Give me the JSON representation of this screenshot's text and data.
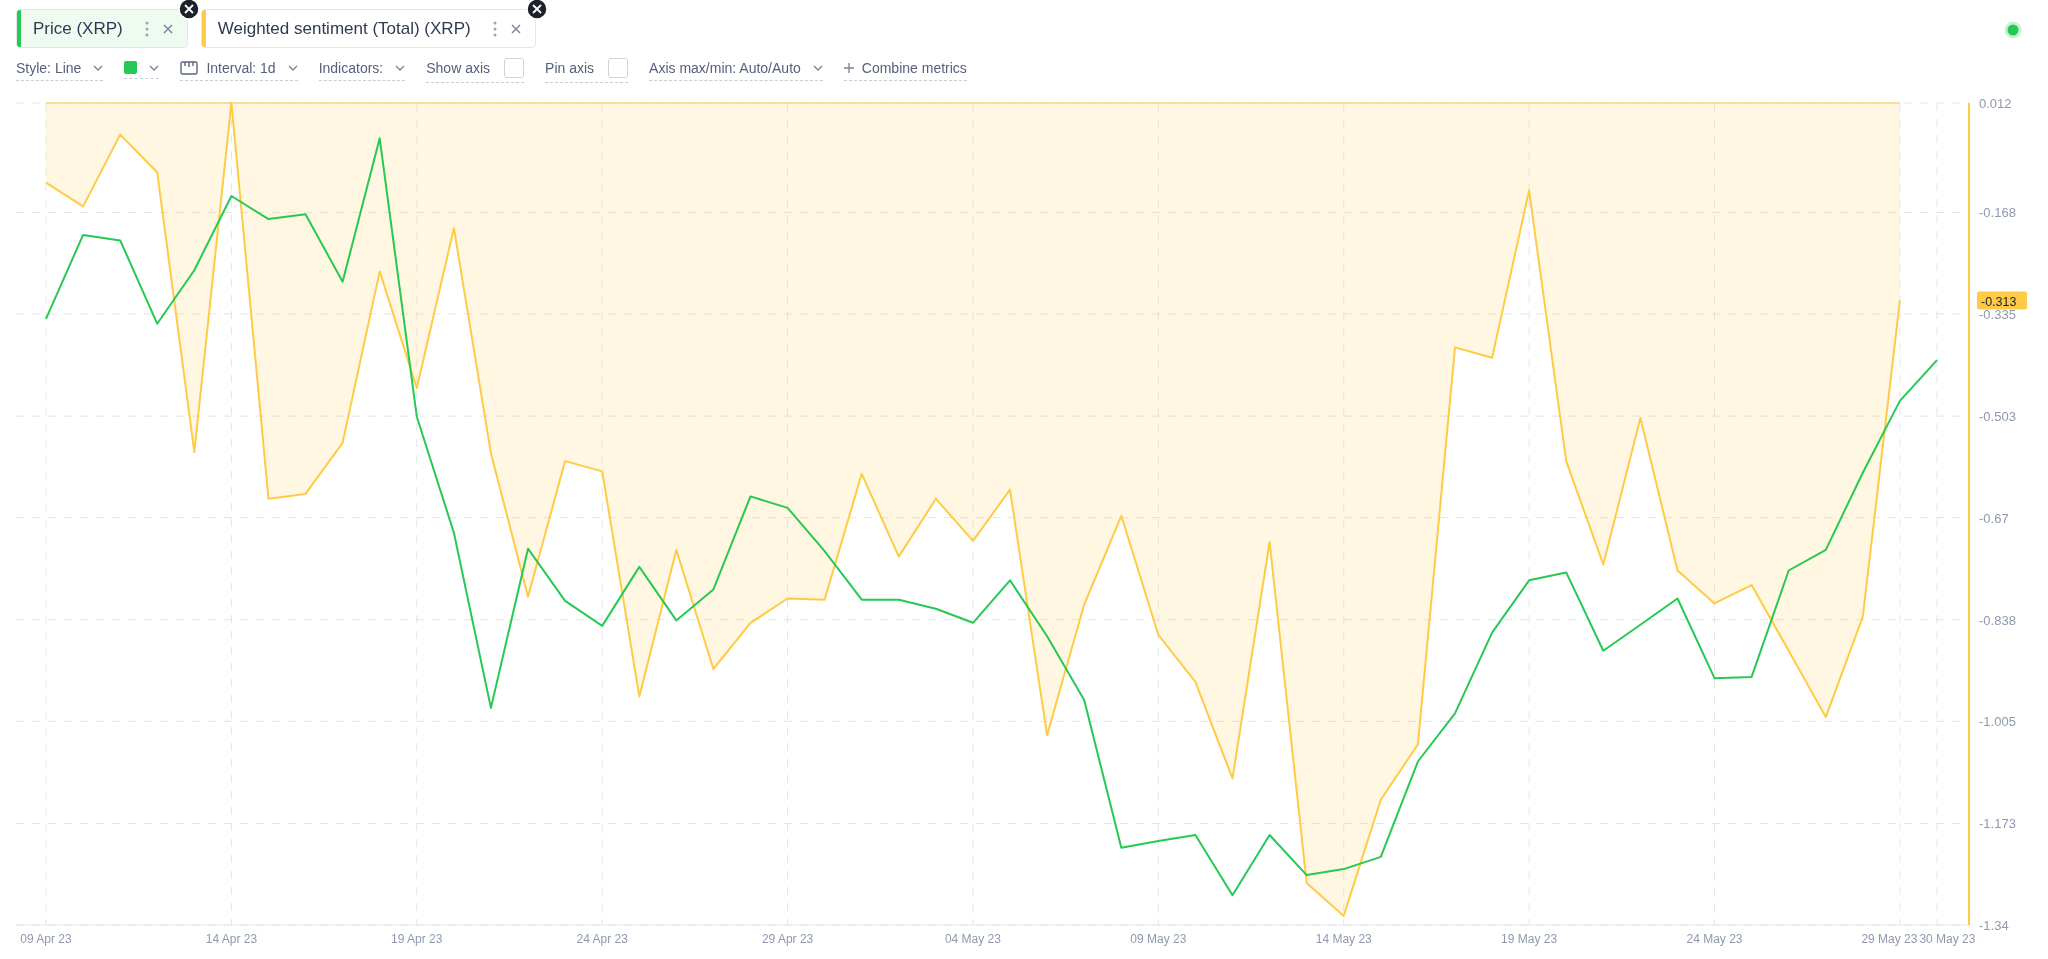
{
  "metrics": [
    {
      "label": "Price (XRP)",
      "color": "#26c953",
      "selected": true
    },
    {
      "label": "Weighted sentiment (Total) (XRP)",
      "color": "#ffcb47",
      "selected": false
    }
  ],
  "live_indicator": {
    "online": true
  },
  "toolbar": [
    {
      "kind": "dropdown",
      "label": "Style: Line"
    },
    {
      "kind": "color",
      "color": "#26c953"
    },
    {
      "kind": "interval",
      "label": "Interval: 1d"
    },
    {
      "kind": "dropdown",
      "label": "Indicators:"
    },
    {
      "kind": "checkbox",
      "label": "Show axis",
      "checked": false
    },
    {
      "kind": "checkbox",
      "label": "Pin axis",
      "checked": false
    },
    {
      "kind": "dropdown",
      "label": "Axis max/min: Auto/Auto"
    },
    {
      "kind": "add",
      "label": "Combine metrics"
    }
  ],
  "current_value": {
    "label": "-0.313"
  },
  "sentiment_shading": {
    "on": true
  },
  "chart_data": {
    "type": "line",
    "categories": [
      "09 Apr 23",
      null,
      null,
      null,
      null,
      "14 Apr 23",
      null,
      null,
      null,
      null,
      "19 Apr 23",
      null,
      null,
      null,
      null,
      "24 Apr 23",
      null,
      null,
      null,
      null,
      "29 Apr 23",
      null,
      null,
      null,
      null,
      "04 May 23",
      null,
      null,
      null,
      null,
      "09 May 23",
      null,
      null,
      null,
      null,
      "14 May 23",
      null,
      null,
      null,
      null,
      "19 May 23",
      null,
      null,
      null,
      null,
      "24 May 23",
      null,
      null,
      null,
      null,
      "29 May 23",
      "30 May 23"
    ],
    "series": [
      {
        "color": "#ffcb47",
        "values": [
          -0.119,
          -0.158,
          -0.04,
          -0.102,
          -0.562,
          0.012,
          -0.639,
          -0.631,
          -0.547,
          -0.265,
          -0.457,
          -0.194,
          -0.564,
          -0.8,
          -0.577,
          -0.594,
          -0.964,
          -0.723,
          -0.919,
          -0.843,
          -0.803,
          -0.805,
          -0.598,
          -0.734,
          -0.639,
          -0.708,
          -0.624,
          -1.028,
          -0.813,
          -0.667,
          -0.863,
          -0.94,
          -1.099,
          -0.71,
          -1.271,
          -1.325,
          -1.134,
          -1.043,
          -0.39,
          -0.407,
          -0.132,
          -0.577,
          -0.747,
          -0.506,
          -0.757,
          -0.811,
          -0.781,
          -0.889,
          -0.998,
          -0.833,
          -0.313,
          null
        ]
      },
      {
        "color": "#26c953",
        "values": [
          -0.343,
          -0.205,
          -0.214,
          -0.351,
          -0.263,
          -0.141,
          -0.179,
          -0.171,
          -0.282,
          -0.046,
          -0.504,
          -0.695,
          -0.983,
          -0.721,
          -0.807,
          -0.848,
          -0.751,
          -0.839,
          -0.788,
          -0.635,
          -0.654,
          -0.725,
          -0.805,
          -0.805,
          -0.82,
          -0.843,
          -0.773,
          -0.865,
          -0.97,
          -1.213,
          -1.202,
          -1.192,
          -1.291,
          -1.192,
          -1.258,
          -1.248,
          -1.228,
          -1.071,
          -0.992,
          -0.859,
          -0.773,
          -0.76,
          -0.889,
          -0.846,
          -0.803,
          -0.934,
          -0.932,
          -0.757,
          -0.723,
          -0.596,
          -0.478,
          -0.411
        ]
      }
    ],
    "ylim": [
      -1.34,
      0.012
    ],
    "yticks": [
      {
        "value": 0.012,
        "label": "0.012"
      },
      {
        "value": -0.168,
        "label": "-0.168"
      },
      {
        "value": -0.335,
        "label": "-0.335"
      },
      {
        "value": -0.503,
        "label": "-0.503"
      },
      {
        "value": -0.67,
        "label": "-0.67"
      },
      {
        "value": -0.838,
        "label": "-0.838"
      },
      {
        "value": -1.005,
        "label": "-1.005"
      },
      {
        "value": -1.173,
        "label": "-1.173"
      },
      {
        "value": -1.34,
        "label": "-1.34"
      }
    ],
    "grid": true
  }
}
